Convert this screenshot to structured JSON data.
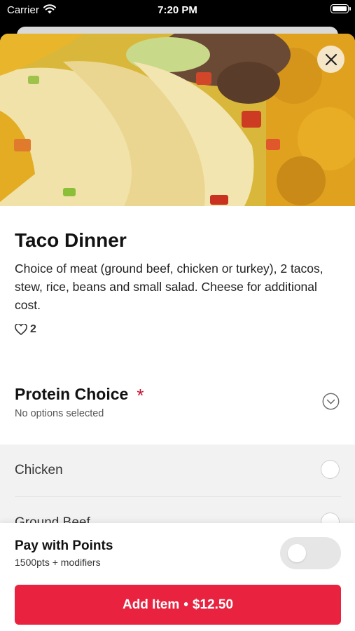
{
  "status_bar": {
    "carrier": "Carrier",
    "time": "7:20 PM"
  },
  "item": {
    "title": "Taco Dinner",
    "description": "Choice of meat (ground beef, chicken or turkey), 2 tacos, stew, rice, beans and small salad. Cheese for additional cost.",
    "likes": "2",
    "image_icon": "taco-dinner-photo"
  },
  "protein_section": {
    "title": "Protein Choice",
    "required_marker": "*",
    "subtitle": "No options selected",
    "options": [
      {
        "label": "Chicken",
        "selected": false
      },
      {
        "label": "Ground Beef",
        "selected": false
      }
    ]
  },
  "points": {
    "title": "Pay with Points",
    "subtitle": "1500pts + modifiers",
    "enabled": false
  },
  "add_button": {
    "label": "Add Item",
    "separator": "•",
    "price": "$12.50"
  },
  "colors": {
    "accent": "#e8223f",
    "required": "#c8102e",
    "close_button_bg": "#f5e6c8",
    "options_bg": "#f2f2f2"
  }
}
